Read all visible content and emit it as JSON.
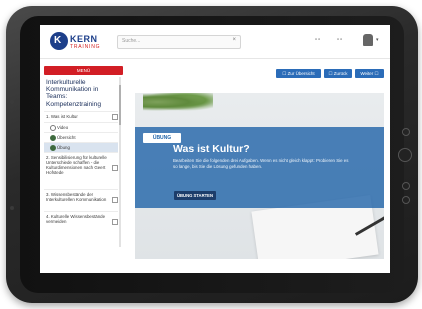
{
  "header": {
    "logo_text": "KERN",
    "logo_sub": "TRAINING",
    "search_placeholder": "Suche...",
    "search_clear": "×",
    "icon_group_1": "▫▫",
    "icon_group_2": "▫▫",
    "avatar_caret": "▾"
  },
  "sidebar": {
    "menu_label": "MENÜ",
    "course_title": "Interkulturelle Kommunikation in Teams: Kompetenztraining",
    "items": [
      {
        "label": "1. Was ist Kultur"
      },
      {
        "label": "2. Sensibilisierung für kulturelle Unterschiede schaffen - die Kulturdimensionen nach Geert Hofstede"
      },
      {
        "label": "3. Wissensbestände der Interkulturellen Kommunikation"
      },
      {
        "label": "4. Kulturelle Wissensbestände vermeiden"
      }
    ],
    "subitems": [
      {
        "label": "Video"
      },
      {
        "label": "Übersicht"
      },
      {
        "label": "Übung"
      }
    ]
  },
  "nav_buttons": {
    "overview": "☐ Zur Übersicht",
    "back": "☐ Zurück",
    "next": "Weiter ☐"
  },
  "hero": {
    "tag": "ÜBUNG",
    "title": "Was ist Kultur?",
    "text": "Bearbeiten Sie die folgenden drei Aufgaben. Wenn es nicht gleich klappt: Probieren Sie es so lange, bis Sie die Lösung gefunden haben.",
    "start_button": "ÜBUNG STARTEN"
  },
  "colors": {
    "brand_blue": "#1d3f8a",
    "brand_red": "#d21e25",
    "button_blue": "#2b6cb8",
    "overlay_blue": "#2466aa"
  }
}
